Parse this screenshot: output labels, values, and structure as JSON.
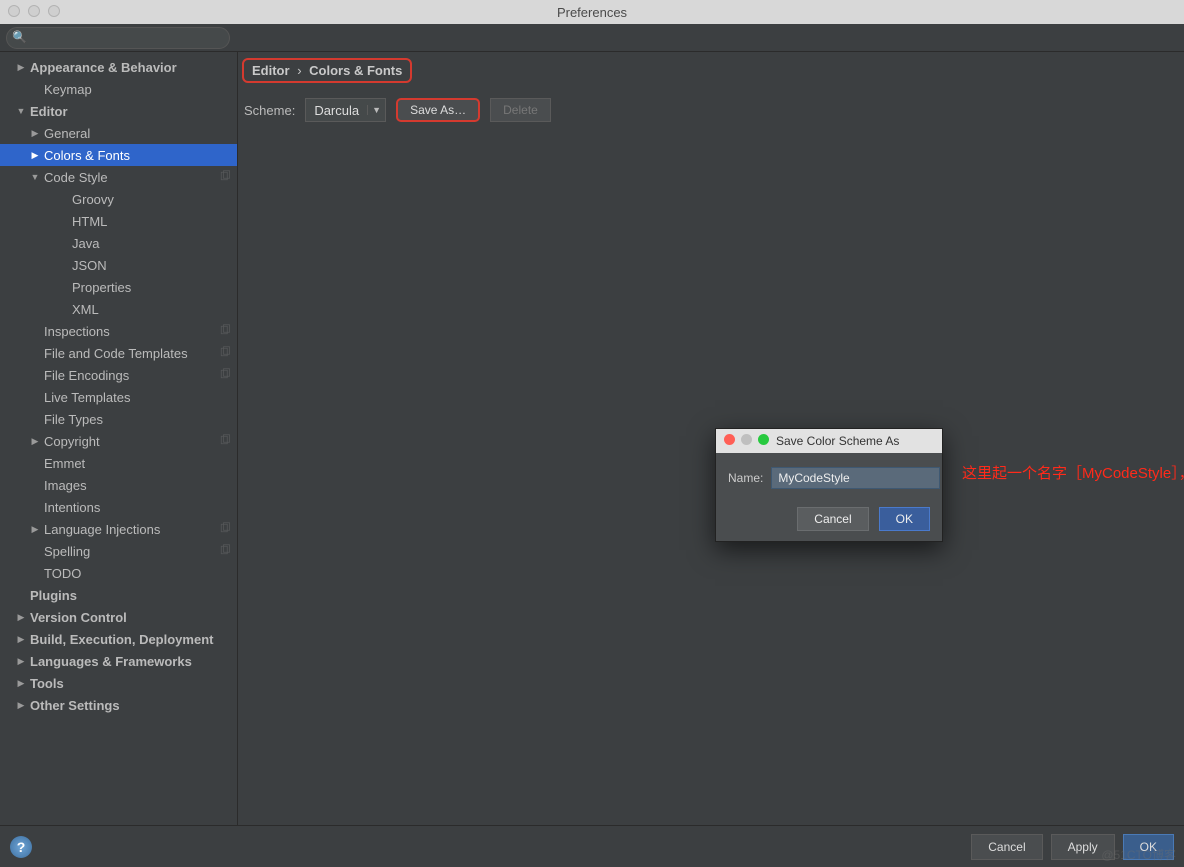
{
  "window": {
    "title": "Preferences"
  },
  "search": {
    "placeholder": ""
  },
  "sidebar": {
    "items": [
      {
        "label": "Appearance & Behavior",
        "indent": 1,
        "arrow": "right"
      },
      {
        "label": "Keymap",
        "indent": 2,
        "arrow": ""
      },
      {
        "label": "Editor",
        "indent": 1,
        "arrow": "down"
      },
      {
        "label": "General",
        "indent": 2,
        "arrow": "right"
      },
      {
        "label": "Colors & Fonts",
        "indent": 2,
        "arrow": "right",
        "selected": true
      },
      {
        "label": "Code Style",
        "indent": 2,
        "arrow": "down",
        "copy": true
      },
      {
        "label": "Groovy",
        "indent": 3,
        "arrow": ""
      },
      {
        "label": "HTML",
        "indent": 3,
        "arrow": ""
      },
      {
        "label": "Java",
        "indent": 3,
        "arrow": ""
      },
      {
        "label": "JSON",
        "indent": 3,
        "arrow": ""
      },
      {
        "label": "Properties",
        "indent": 3,
        "arrow": ""
      },
      {
        "label": "XML",
        "indent": 3,
        "arrow": ""
      },
      {
        "label": "Inspections",
        "indent": 2,
        "arrow": "",
        "copy": true
      },
      {
        "label": "File and Code Templates",
        "indent": 2,
        "arrow": "",
        "copy": true
      },
      {
        "label": "File Encodings",
        "indent": 2,
        "arrow": "",
        "copy": true
      },
      {
        "label": "Live Templates",
        "indent": 2,
        "arrow": ""
      },
      {
        "label": "File Types",
        "indent": 2,
        "arrow": ""
      },
      {
        "label": "Copyright",
        "indent": 2,
        "arrow": "right",
        "copy": true
      },
      {
        "label": "Emmet",
        "indent": 2,
        "arrow": ""
      },
      {
        "label": "Images",
        "indent": 2,
        "arrow": ""
      },
      {
        "label": "Intentions",
        "indent": 2,
        "arrow": ""
      },
      {
        "label": "Language Injections",
        "indent": 2,
        "arrow": "right",
        "copy": true
      },
      {
        "label": "Spelling",
        "indent": 2,
        "arrow": "",
        "copy": true
      },
      {
        "label": "TODO",
        "indent": 2,
        "arrow": ""
      },
      {
        "label": "Plugins",
        "indent": 1,
        "arrow": ""
      },
      {
        "label": "Version Control",
        "indent": 1,
        "arrow": "right"
      },
      {
        "label": "Build, Execution, Deployment",
        "indent": 1,
        "arrow": "right"
      },
      {
        "label": "Languages & Frameworks",
        "indent": 1,
        "arrow": "right"
      },
      {
        "label": "Tools",
        "indent": 1,
        "arrow": "right"
      },
      {
        "label": "Other Settings",
        "indent": 1,
        "arrow": "right"
      }
    ]
  },
  "breadcrumb": {
    "part1": "Editor",
    "sep": "›",
    "part2": "Colors & Fonts"
  },
  "scheme": {
    "label": "Scheme:",
    "value": "Darcula",
    "saveAs": "Save As…",
    "delete": "Delete"
  },
  "modal": {
    "title": "Save Color Scheme As",
    "nameLabel": "Name:",
    "nameValue": "MyCodeStyle",
    "cancel": "Cancel",
    "ok": "OK"
  },
  "annotation": "这里起一个名字［MyCodeStyle］，然后点击OK",
  "footer": {
    "cancel": "Cancel",
    "apply": "Apply",
    "ok": "OK"
  },
  "watermark": "@51CTO博客"
}
